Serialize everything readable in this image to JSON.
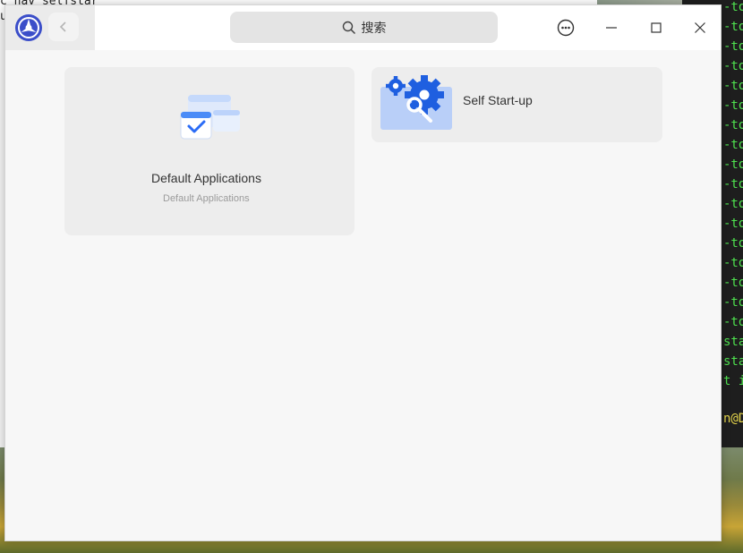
{
  "background": {
    "doc_line1": "c_nav_selfstar",
    "doc_line2": "u",
    "terminal_lines": [
      "-to",
      "-to",
      "-to",
      "-to",
      "-to",
      "-to",
      "-to",
      "-to",
      "-to",
      "-to",
      "-to",
      "-to",
      "-to",
      "-to",
      "-to",
      "-to",
      "-to",
      "sta",
      "sta",
      "t i"
    ],
    "terminal_prompt": "n@D"
  },
  "titlebar": {
    "back_icon": "chevron-left-icon",
    "search_placeholder": "搜索",
    "menu_icon": "more-icon",
    "minimize_icon": "minimize-icon",
    "maximize_icon": "maximize-icon",
    "close_icon": "close-icon"
  },
  "cards": [
    {
      "title": "Default Applications",
      "subtitle": "Default Applications",
      "icon": "default-apps-icon"
    },
    {
      "title": "Self Start-up",
      "icon": "self-startup-icon"
    }
  ],
  "colors": {
    "accent": "#2b6cf6",
    "terminal_text": "#4ee04e"
  }
}
